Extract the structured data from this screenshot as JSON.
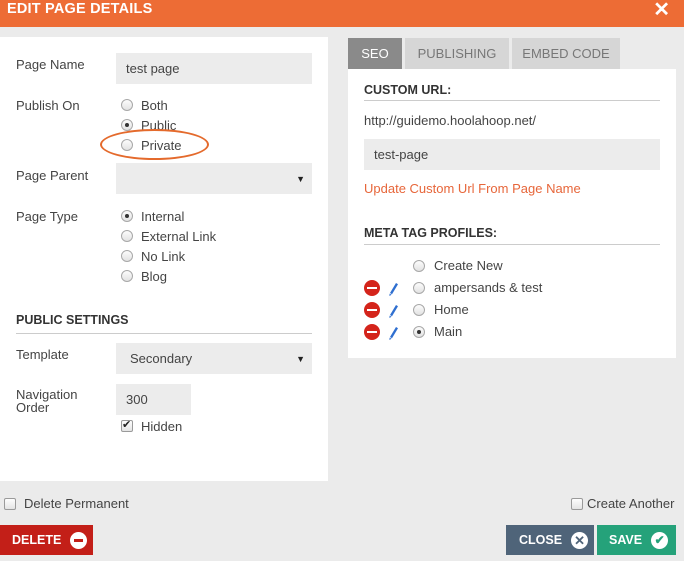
{
  "dialog": {
    "title": "EDIT PAGE DETAILS",
    "close_glyph": "✕"
  },
  "form": {
    "page_name_label": "Page Name",
    "page_name_value": "test page",
    "publish_on_label": "Publish On",
    "publish_options": [
      {
        "label": "Both",
        "checked": false
      },
      {
        "label": "Public",
        "checked": true
      },
      {
        "label": "Private",
        "checked": false
      }
    ],
    "page_parent_label": "Page Parent",
    "page_parent_value": "",
    "page_type_label": "Page Type",
    "page_type_options": [
      {
        "label": "Internal",
        "checked": true
      },
      {
        "label": "External Link",
        "checked": false
      },
      {
        "label": "No Link",
        "checked": false
      },
      {
        "label": "Blog",
        "checked": false
      }
    ],
    "public_settings_heading": "PUBLIC SETTINGS",
    "template_label": "Template",
    "template_value": "Secondary",
    "nav_order_label_line1": "Navigation",
    "nav_order_label_line2": "Order",
    "nav_order_value": "300",
    "hidden_label": "Hidden",
    "hidden_checked": true
  },
  "tabs": [
    {
      "label": "SEO",
      "active": true
    },
    {
      "label": "PUBLISHING",
      "active": false
    },
    {
      "label": "EMBED CODE",
      "active": false
    }
  ],
  "seo": {
    "custom_url_heading": "CUSTOM URL:",
    "base_url": "http://guidemo.hoolahoop.net/",
    "slug_value": "test-page",
    "update_link": "Update Custom Url From Page Name",
    "meta_heading": "META TAG PROFILES:",
    "profiles": [
      {
        "label": "Create New",
        "checked": false,
        "editable": false
      },
      {
        "label": "ampersands & test",
        "checked": false,
        "editable": true
      },
      {
        "label": "Home",
        "checked": false,
        "editable": true
      },
      {
        "label": "Main",
        "checked": true,
        "editable": true
      }
    ]
  },
  "footer": {
    "delete_permanent_label": "Delete Permanent",
    "create_another_label": "Create Another",
    "delete_button": "DELETE",
    "close_button": "CLOSE",
    "save_button": "SAVE"
  },
  "colors": {
    "titlebar": "#ed6c35",
    "delete": "#c31f18",
    "close": "#4f6479",
    "save": "#25a27a",
    "link": "#e7663a"
  },
  "icons": {
    "close": "close-icon",
    "remove": "minus-circle-icon",
    "edit": "pencil-icon",
    "select": "caret-down-icon",
    "save": "checkmark-icon"
  }
}
